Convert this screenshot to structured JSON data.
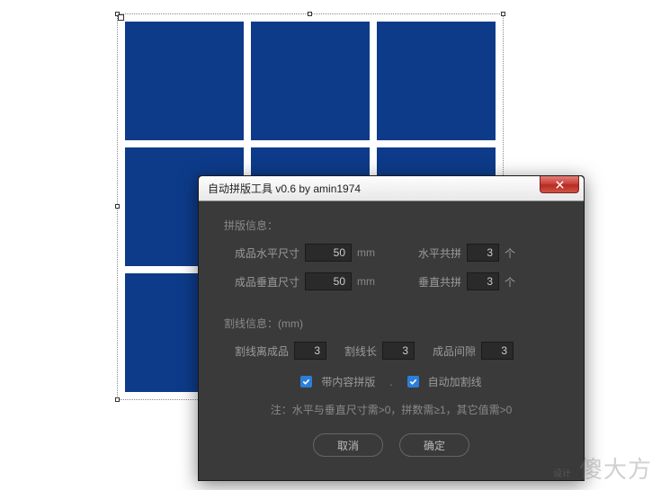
{
  "dialog": {
    "title": "自动拼版工具 v0.6   by amin1974",
    "section1_label": "拼版信息：",
    "horiz_size_label": "成品水平尺寸",
    "horiz_size_value": "50",
    "horiz_size_unit": "mm",
    "horiz_count_label": "水平共拼",
    "horiz_count_value": "3",
    "horiz_count_unit": "个",
    "vert_size_label": "成品垂直尺寸",
    "vert_size_value": "50",
    "vert_size_unit": "mm",
    "vert_count_label": "垂直共拼",
    "vert_count_value": "3",
    "vert_count_unit": "个",
    "section2_label": "割线信息：(mm)",
    "cut_dist_label": "割线离成品",
    "cut_dist_value": "3",
    "cut_len_label": "割线长",
    "cut_len_value": "3",
    "gap_label": "成品间隙",
    "gap_value": "3",
    "chk1_label": "带内容拼版",
    "chk2_label": "自动加割线",
    "note_text": "注：水平与垂直尺寸需>0，拼数需≥1，其它值需>0",
    "cancel_label": "取消",
    "ok_label": "确定"
  },
  "watermark": "傻大方",
  "watermark_sub": "设计"
}
